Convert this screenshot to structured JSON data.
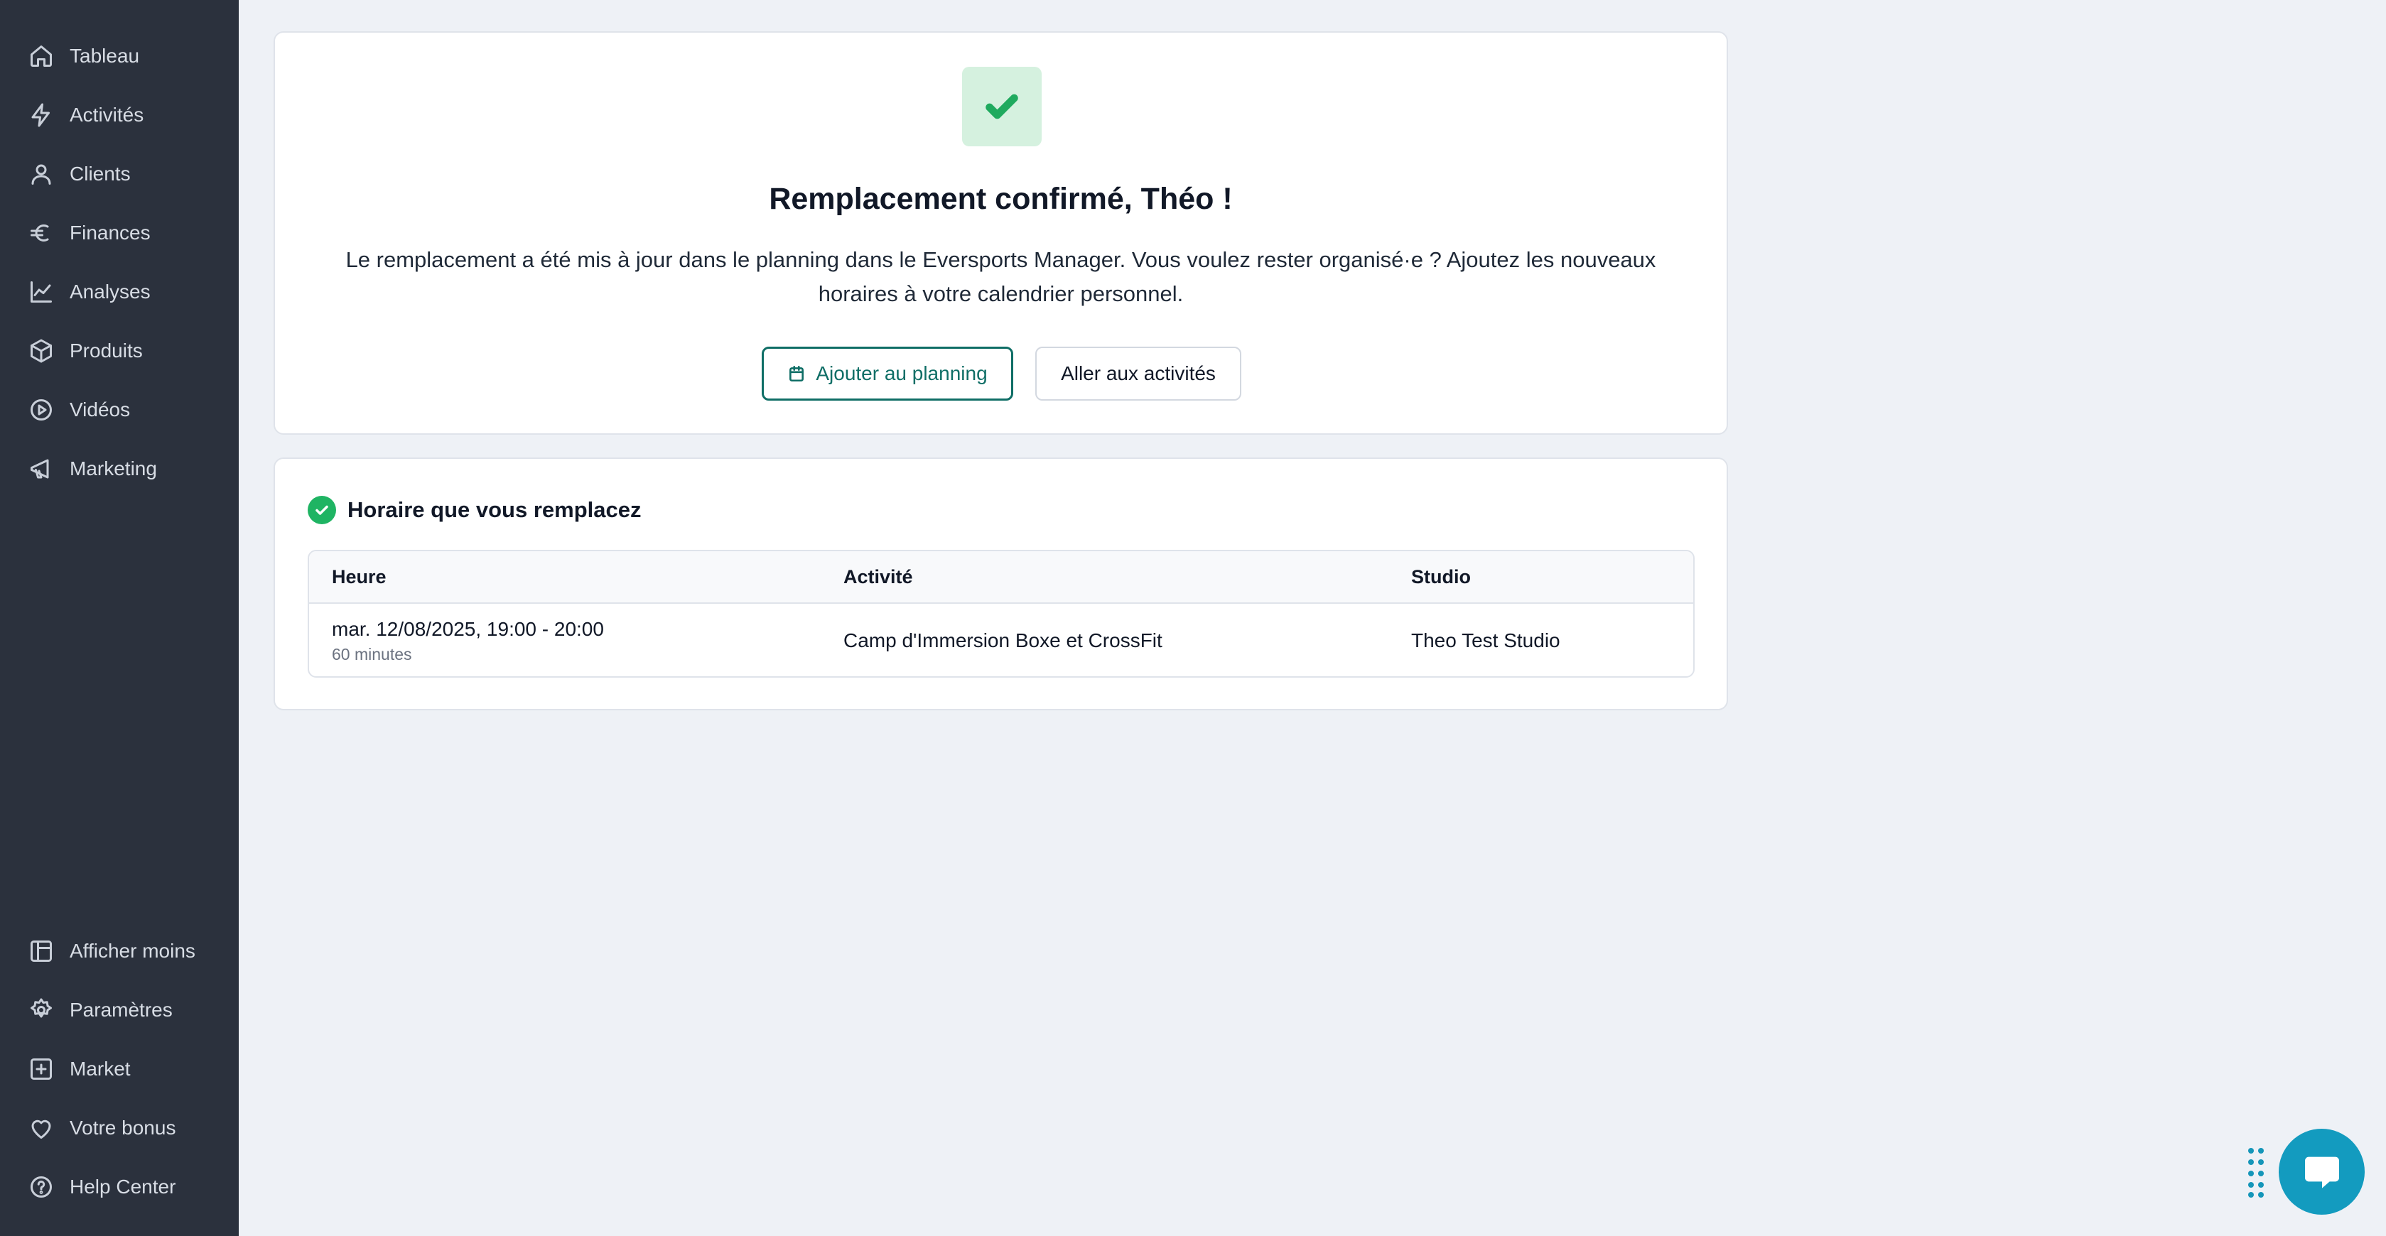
{
  "sidebar": {
    "top_items": [
      {
        "label": "Tableau",
        "icon": "home-icon"
      },
      {
        "label": "Activités",
        "icon": "lightning-icon"
      },
      {
        "label": "Clients",
        "icon": "user-icon"
      },
      {
        "label": "Finances",
        "icon": "euro-icon"
      },
      {
        "label": "Analyses",
        "icon": "chart-line-icon"
      },
      {
        "label": "Produits",
        "icon": "box-icon"
      },
      {
        "label": "Vidéos",
        "icon": "play-circle-icon"
      },
      {
        "label": "Marketing",
        "icon": "megaphone-icon"
      }
    ],
    "bottom_items": [
      {
        "label": "Afficher moins",
        "icon": "layout-icon"
      },
      {
        "label": "Paramètres",
        "icon": "gear-icon"
      },
      {
        "label": "Market",
        "icon": "plus-square-icon"
      },
      {
        "label": "Votre bonus",
        "icon": "heart-icon"
      },
      {
        "label": "Help Center",
        "icon": "help-circle-icon"
      }
    ]
  },
  "confirmation": {
    "icon": "checkmark-icon",
    "title": "Remplacement confirmé, Théo !",
    "message": "Le remplacement a été mis à jour dans le planning dans le Eversports Manager. Vous voulez rester organisé·e ? Ajoutez les nouveaux horaires à votre calendrier personnel.",
    "primary_button": "Ajouter au planning",
    "secondary_button": "Aller aux activités"
  },
  "schedule": {
    "title": "Horaire que vous remplacez",
    "columns": [
      "Heure",
      "Activité",
      "Studio"
    ],
    "rows": [
      {
        "time": "mar. 12/08/2025, 19:00 - 20:00",
        "duration": "60 minutes",
        "activity": "Camp d'Immersion Boxe et CrossFit",
        "studio": "Theo Test Studio"
      }
    ]
  },
  "colors": {
    "sidebar_bg": "#2b313d",
    "accent": "#0f6e66",
    "success": "#1fb463",
    "chat": "#139bbf"
  }
}
